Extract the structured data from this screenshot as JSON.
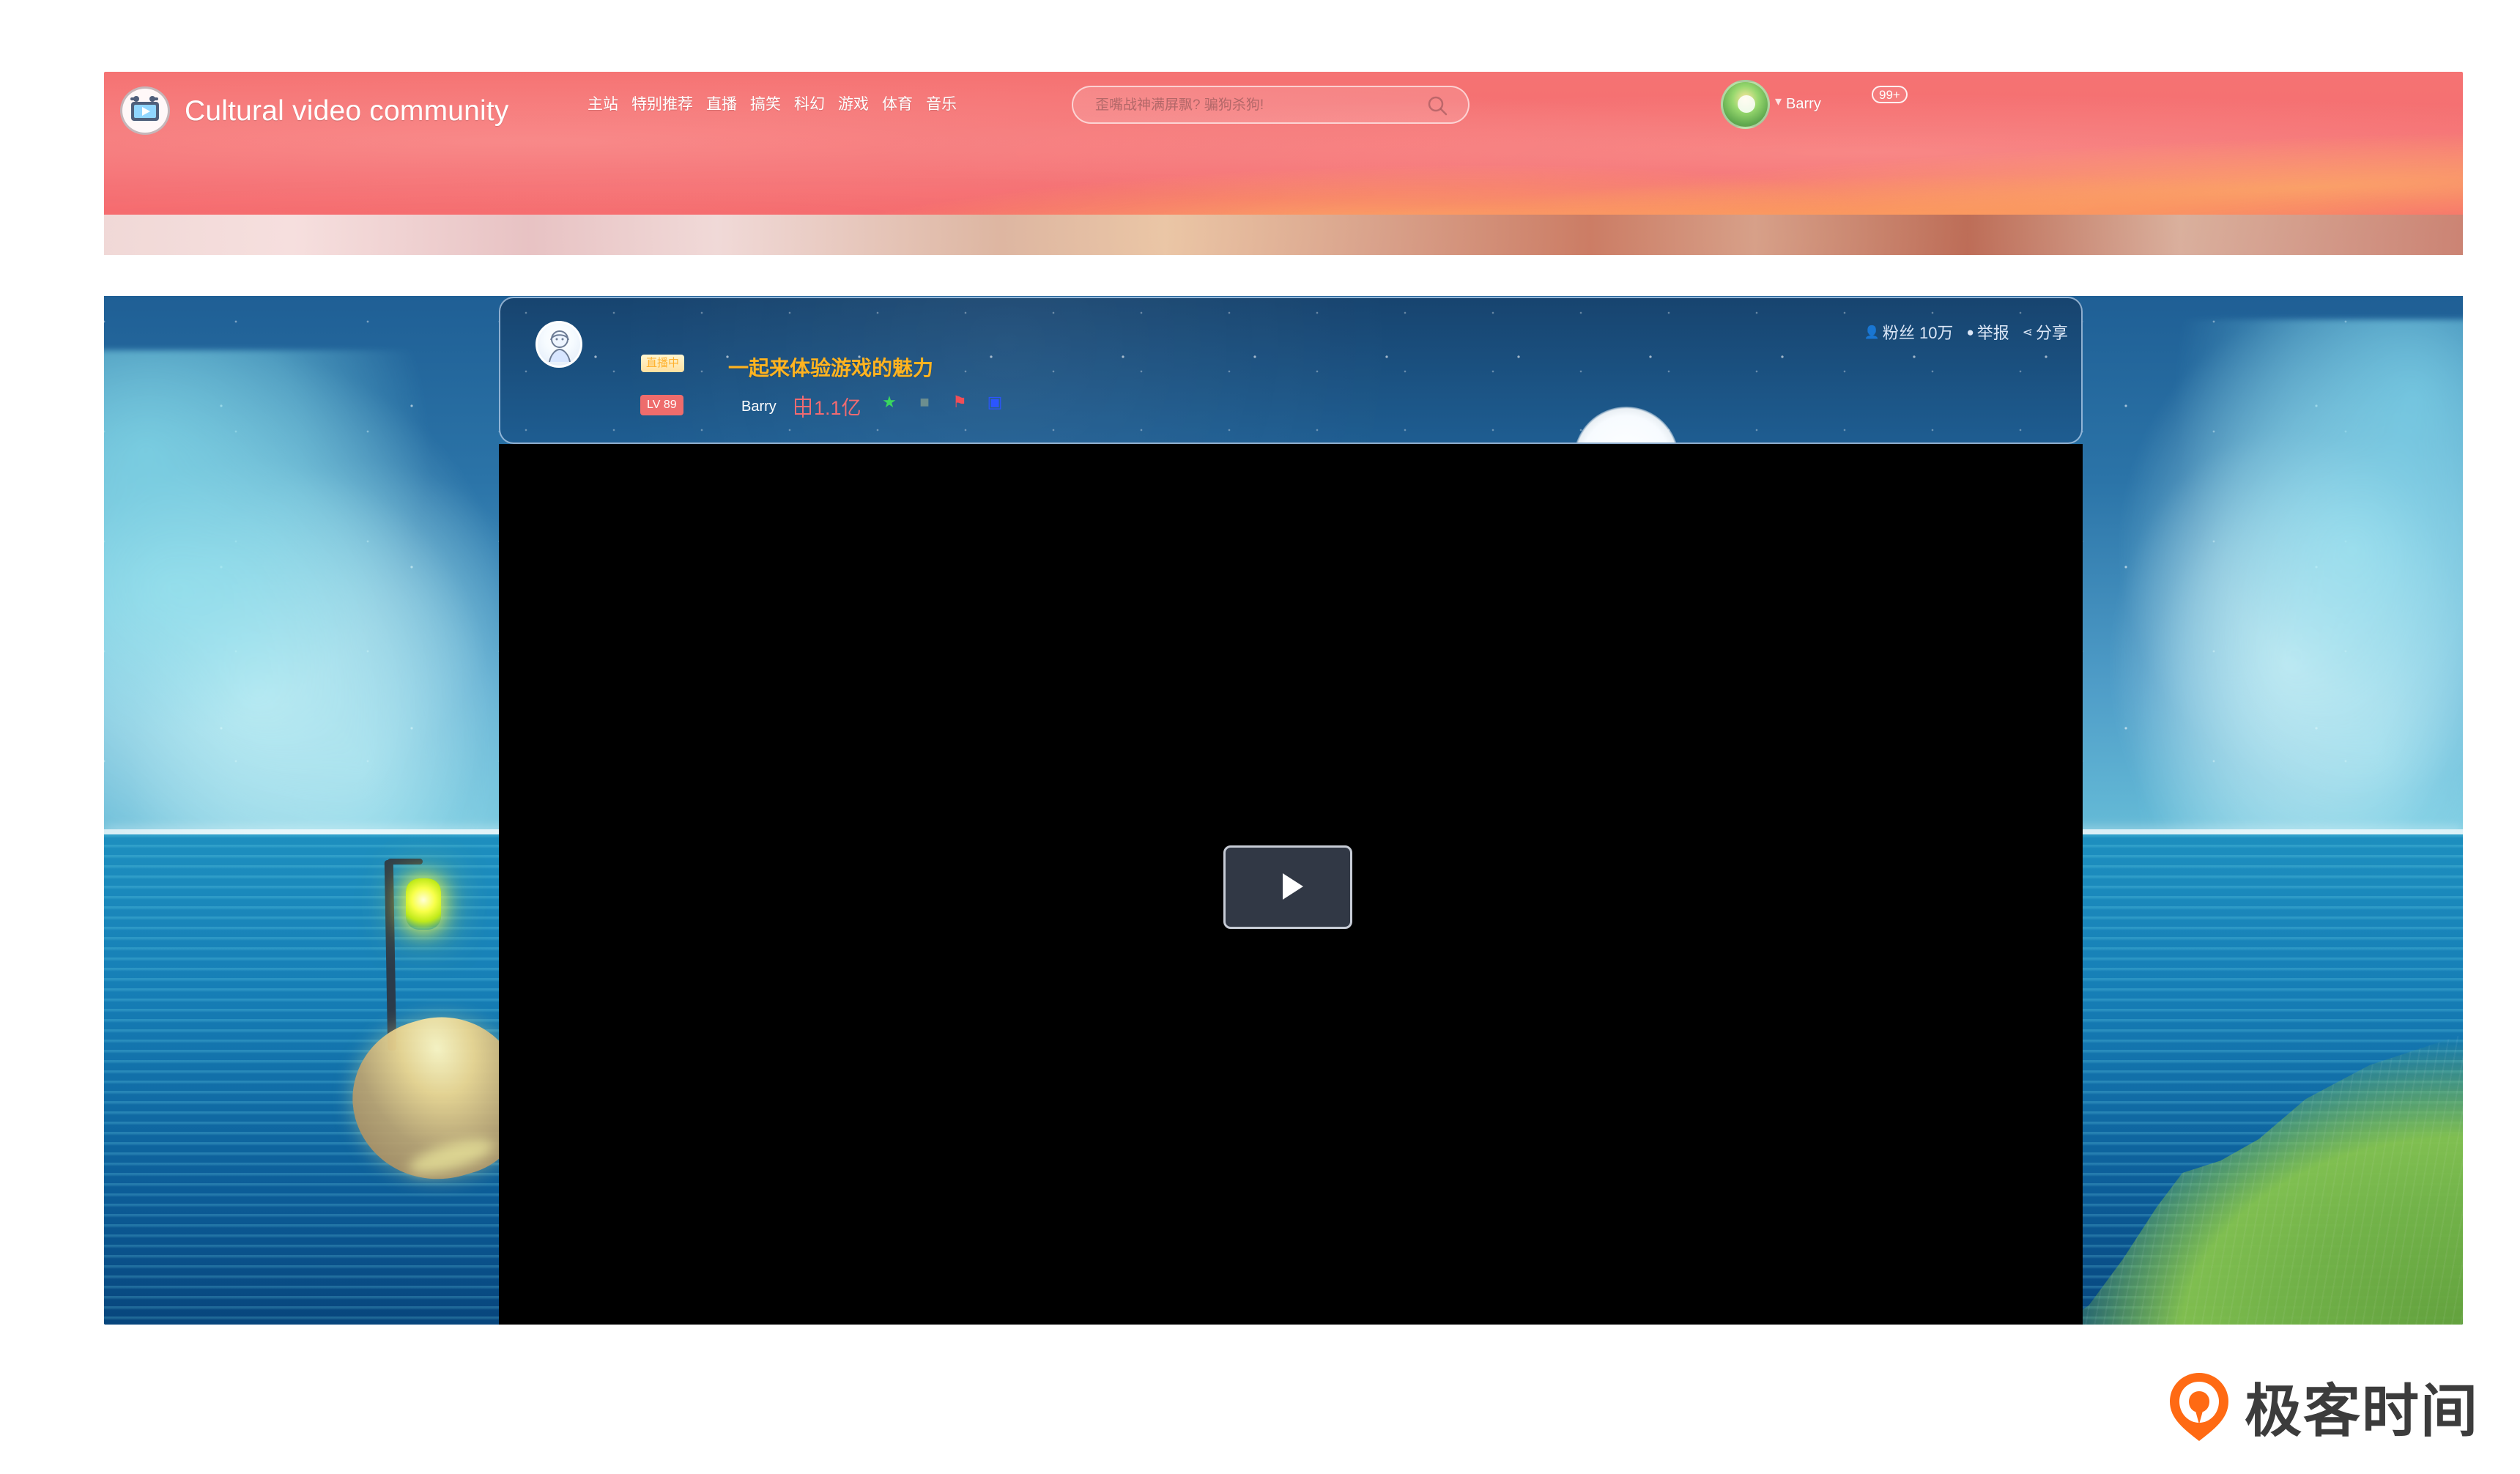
{
  "header": {
    "site_title": "Cultural video community",
    "nav": [
      "主站",
      "特别推荐",
      "直播",
      "搞笑",
      "科幻",
      "游戏",
      "体育",
      "音乐"
    ],
    "search": {
      "placeholder": "歪嘴战神满屏飘? 骗狗杀狗!",
      "icon": "search-icon"
    },
    "user": {
      "name": "Barry",
      "badge": "99+",
      "avatar_icon": "avatar-icon",
      "dropdown_icon": "caret-down-icon"
    },
    "colors": {
      "header_bg": "#f46a6f",
      "highlight": "#ffb320"
    }
  },
  "room": {
    "live_badge": "直播中",
    "title": "一起来体验游戏的魅力",
    "level": "LV 89",
    "streamer": "Barry",
    "heat": "1.1亿",
    "icons": [
      "star-icon",
      "camera-icon",
      "flag-icon",
      "robot-icon"
    ],
    "tools": {
      "fans": "粉丝 10万",
      "report": "举报",
      "share": "分享"
    }
  },
  "player": {
    "play_icon": "play-icon",
    "background": "#000000",
    "button_bg": "#313845"
  },
  "watermark": {
    "text": "极客时间"
  }
}
